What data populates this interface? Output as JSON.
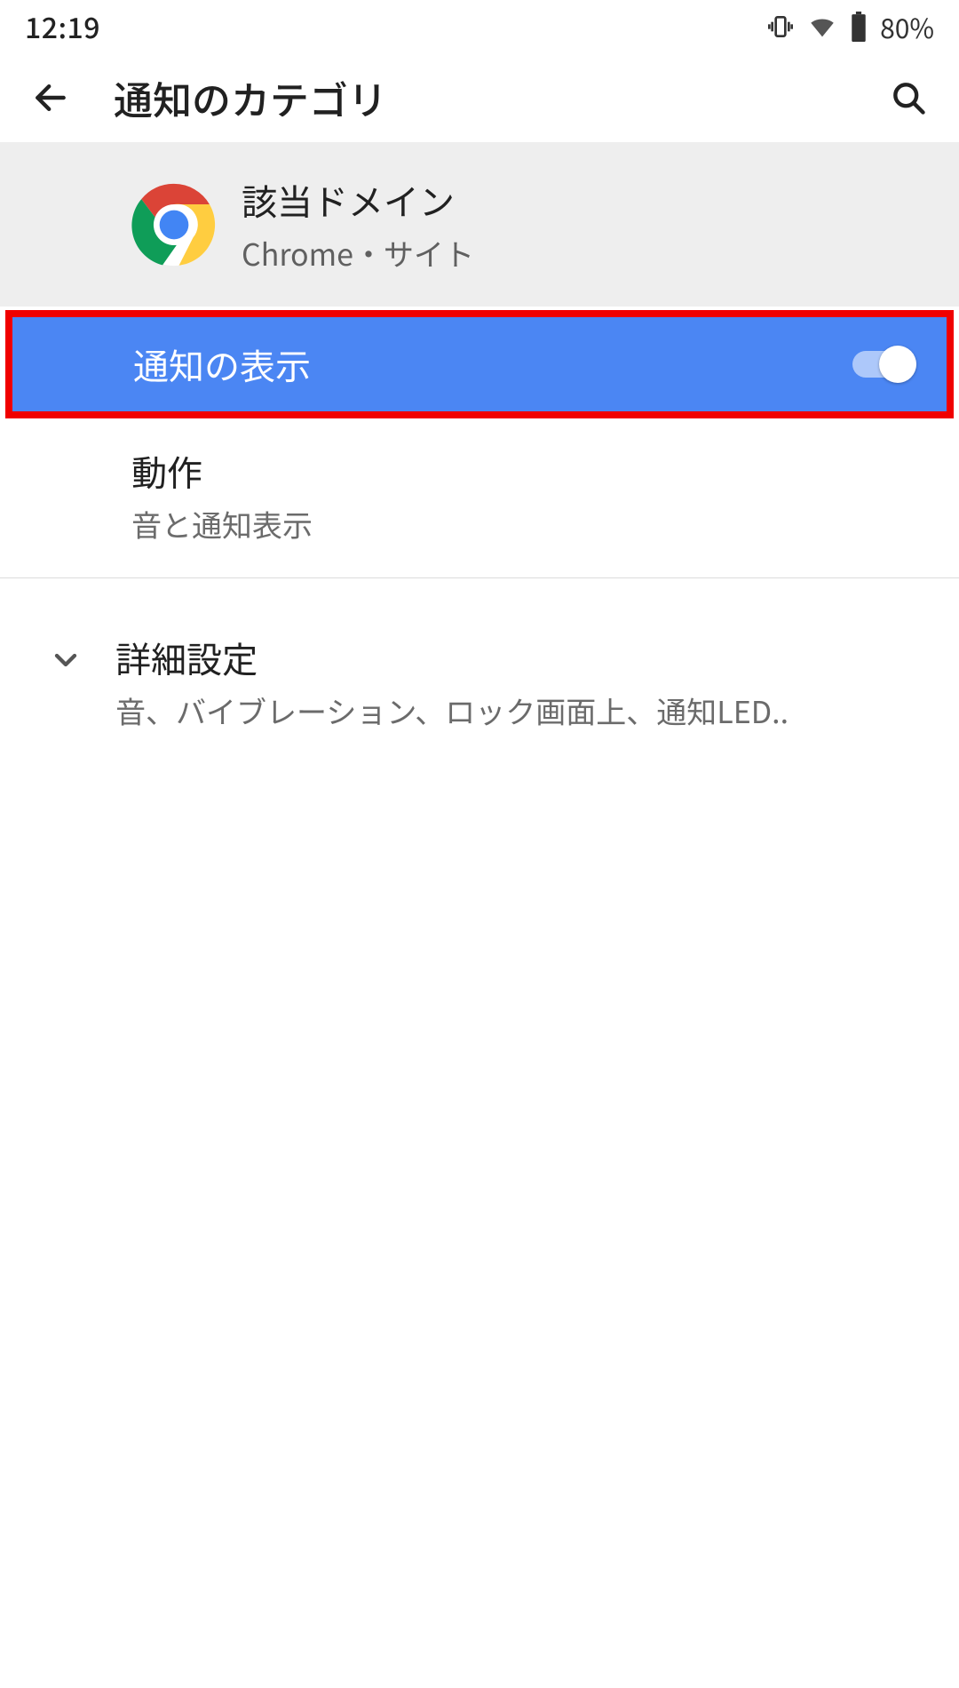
{
  "status_bar": {
    "time": "12:19",
    "battery_pct": "80%"
  },
  "app_bar": {
    "title": "通知のカテゴリ"
  },
  "app_section": {
    "domain": "該当ドメイン",
    "sub": "Chrome・サイト"
  },
  "toggle": {
    "label": "通知の表示",
    "state": "on"
  },
  "behavior": {
    "title": "動作",
    "sub": "音と通知表示"
  },
  "advanced": {
    "title": "詳細設定",
    "sub": "音、バイブレーション、ロック画面上、通知LED.."
  }
}
